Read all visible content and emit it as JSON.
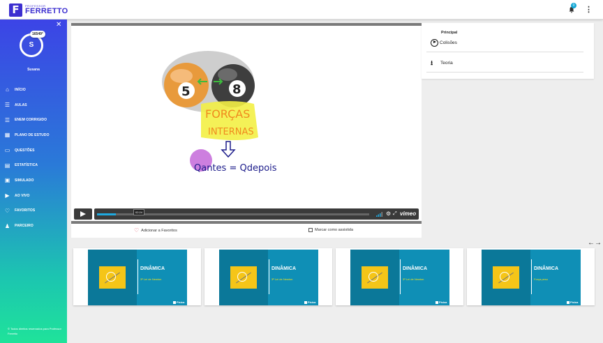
{
  "header": {
    "logo_small": "PROFESSOR",
    "logo_text": "FERRETTO",
    "logo_letter": "F",
    "notification_count": "0",
    "menu_glyph": "⋮"
  },
  "sidebar": {
    "close_glyph": "✕",
    "points": "16549°",
    "avatar_letter": "S",
    "username": "Susana",
    "items": [
      {
        "label": "INÍCIO",
        "icon": "home-icon",
        "glyph": "⌂"
      },
      {
        "label": "AULAS",
        "icon": "list-icon",
        "glyph": "☰"
      },
      {
        "label": "ENEM CORRIGIDO",
        "icon": "list-icon",
        "glyph": "☰"
      },
      {
        "label": "PLANO DE ESTUDO",
        "icon": "calendar-icon",
        "glyph": "▦"
      },
      {
        "label": "QUESTÕES",
        "icon": "folder-icon",
        "glyph": "▭"
      },
      {
        "label": "ESTATÍSTICA",
        "icon": "chart-icon",
        "glyph": "▤"
      },
      {
        "label": "SIMULADO",
        "icon": "checklist-icon",
        "glyph": "▣"
      },
      {
        "label": "AO VIVO",
        "icon": "live-icon",
        "glyph": "▶"
      },
      {
        "label": "FAVORITOS",
        "icon": "heart-icon",
        "glyph": "♡"
      },
      {
        "label": "PARCEIRO",
        "icon": "people-icon",
        "glyph": "♟"
      }
    ],
    "copyright": "© Todos direitos reservados para Professor Ferretto"
  },
  "player": {
    "timecode": "02:24",
    "progress_fraction": 0.07,
    "brand": "vimeo",
    "drawing": {
      "ball_left": "5",
      "ball_right": "8",
      "line1": "FORÇAS",
      "line2": "INTERNAS",
      "equation": "Qantes = Qdepois"
    }
  },
  "actions": {
    "favorite_label": "Adicionar a Favoritos",
    "watched_label": "Marcar como assistida"
  },
  "panel": {
    "title": "Principal",
    "items": [
      {
        "label": "Colisões",
        "icon": "play-circle-icon"
      },
      {
        "label": "Teoria",
        "icon": "download-icon"
      }
    ]
  },
  "carousel": {
    "prev_glyph": "←",
    "next_glyph": "→",
    "items": [
      {
        "title": "DINÂMICA",
        "subtitle": "3ª Lei de Newton",
        "badge": "Física"
      },
      {
        "title": "DINÂMICA",
        "subtitle": "3ª Lei de Newton",
        "badge": "Física"
      },
      {
        "title": "DINÂMICA",
        "subtitle": "3ª Lei de Newton",
        "badge": "Física"
      },
      {
        "title": "DINÂMICA",
        "subtitle": "Força peso",
        "badge": "Física"
      }
    ]
  }
}
